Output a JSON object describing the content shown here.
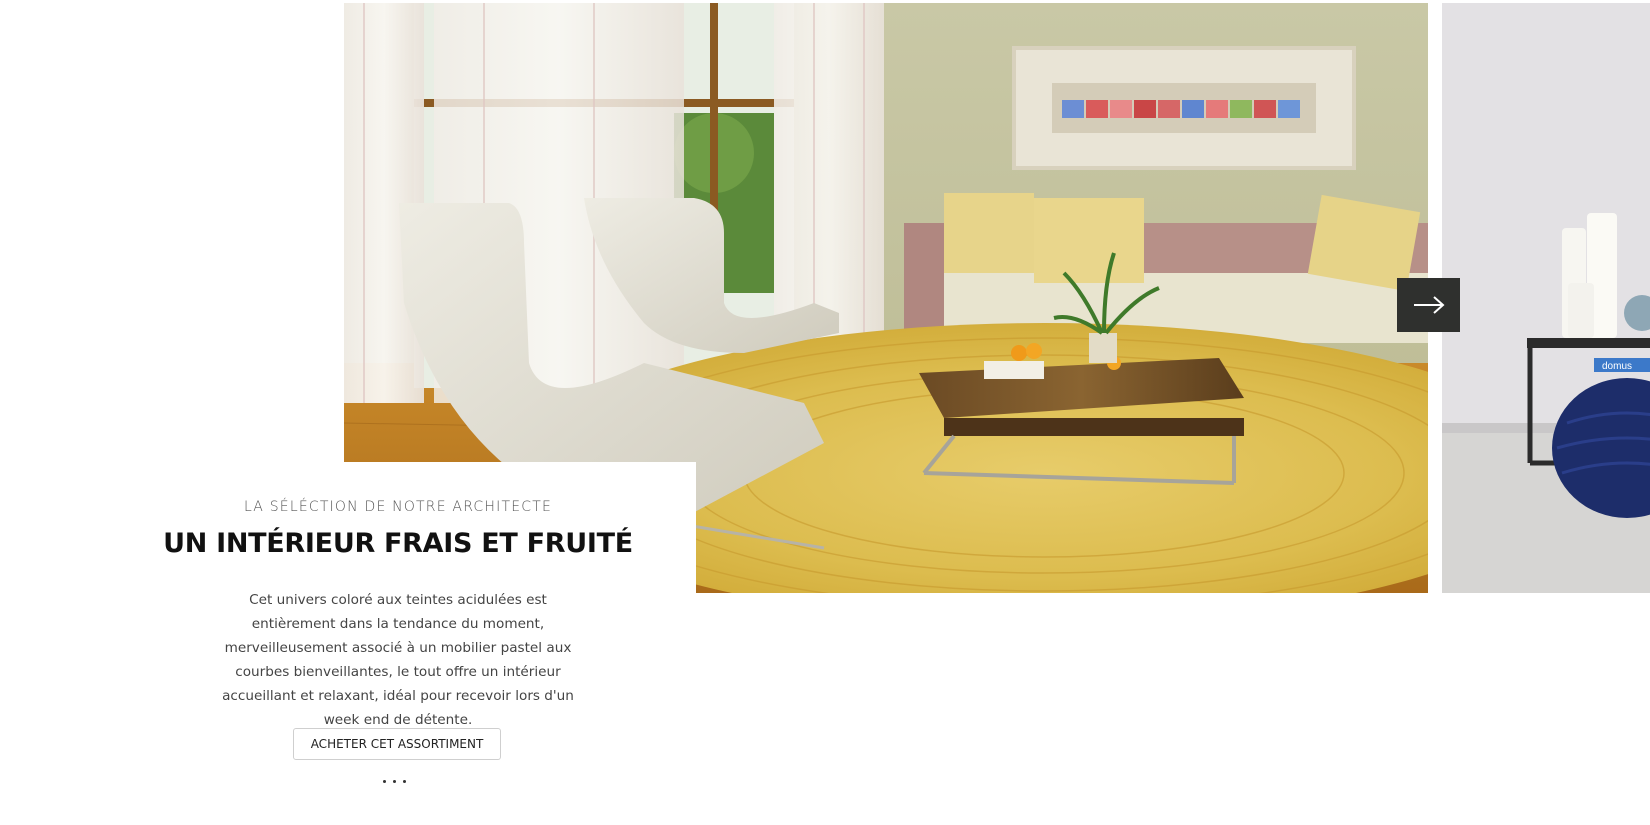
{
  "slide": {
    "eyebrow": "LA SÉLÉCTION DE NOTRE ARCHITECTE",
    "title": "UN INTÉRIEUR FRAIS ET FRUITÉ",
    "description": "Cet univers coloré aux teintes acidulées est entièrement dans la tendance du moment, merveilleusement associé à un mobilier pastel aux courbes bienveillantes, le tout offre un intérieur accueillant et relaxant, idéal pour recevoir lors d'un week end de détente.",
    "button_label": "ACHETER CET ASSORTIMENT"
  },
  "carousel": {
    "next_icon": "arrow-right-icon",
    "dots": 3,
    "active_dot": 0
  },
  "image_labels": {
    "book_label": "domus"
  },
  "colors": {
    "arrow_bg": "#2f302e",
    "title": "#111111",
    "text": "#444444"
  }
}
